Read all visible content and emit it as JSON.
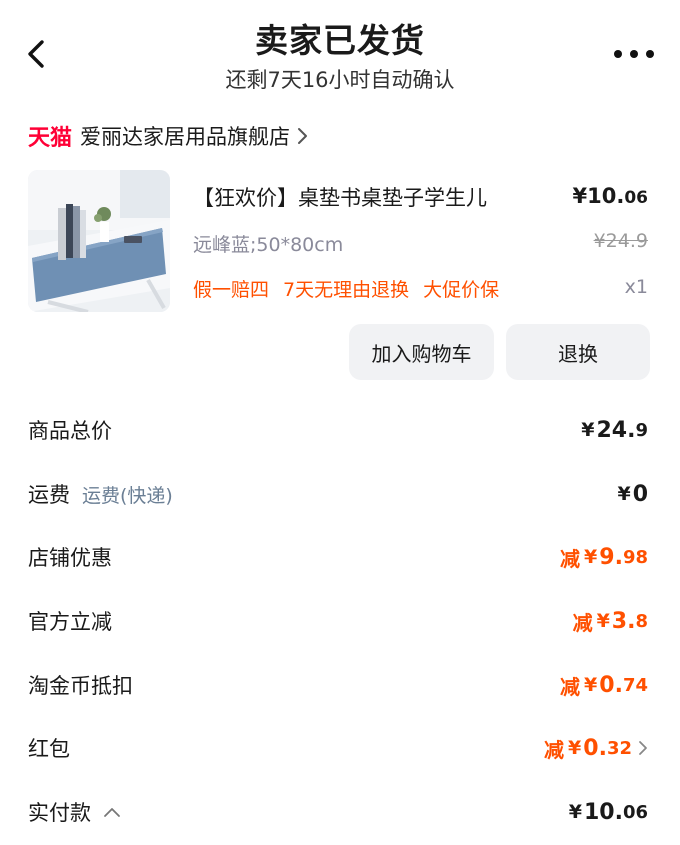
{
  "header": {
    "title": "卖家已发货",
    "subtitle": "还剩7天16小时自动确认"
  },
  "store": {
    "badge": "天猫",
    "name": "爱丽达家居用品旗舰店"
  },
  "product": {
    "title": "【狂欢价】桌垫书桌垫子学生儿",
    "price_main": "¥10.",
    "price_decimal": "06",
    "sku": "远峰蓝;50*80cm",
    "original_price": "¥24.9",
    "tags": [
      "假一赔四",
      "7天无理由退换",
      "大促价保"
    ],
    "quantity": "x1"
  },
  "actions": {
    "add_to_cart": "加入购物车",
    "return": "退换"
  },
  "summary": {
    "total": {
      "label": "商品总价",
      "yen": "¥",
      "main": "24.",
      "decimal": "9"
    },
    "shipping": {
      "label": "运费",
      "sub": "运费(快递)",
      "yen": "¥",
      "main": "0"
    },
    "store_discount": {
      "label": "店铺优惠",
      "prefix": "减",
      "yen": "¥",
      "main": "9.",
      "decimal": "98"
    },
    "official_discount": {
      "label": "官方立减",
      "prefix": "减",
      "yen": "¥",
      "main": "3.",
      "decimal": "8"
    },
    "coin_deduction": {
      "label": "淘金币抵扣",
      "prefix": "减",
      "yen": "¥",
      "main": "0.",
      "decimal": "74"
    },
    "red_packet": {
      "label": "红包",
      "prefix": "减",
      "yen": "¥",
      "main": "0.",
      "decimal": "32"
    },
    "paid": {
      "label": "实付款",
      "yen": "¥",
      "main": "10.",
      "decimal": "06"
    }
  },
  "colors": {
    "accent_orange": "#ff5000",
    "tmall_red": "#ff0036",
    "button_bg": "#f1f2f4"
  }
}
